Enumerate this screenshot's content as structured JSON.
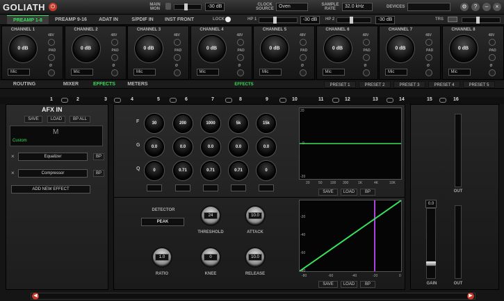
{
  "app": {
    "title": "GOLIATH"
  },
  "top": {
    "main_mon_label": "MAIN MON",
    "main_mon_db": "-30 dB",
    "clock_source_label": "CLOCK SOURCE",
    "clock_source_value": "Oven",
    "sample_rate_label": "SAMPLE RATE",
    "sample_rate_value": "32.0 kHz",
    "devices_label": "DEVICES"
  },
  "tabs": [
    "PREAMP 1-8",
    "PREAMP 9-16",
    "ADAT IN",
    "S/PDIF IN",
    "INST FRONT"
  ],
  "hp": {
    "lock_label": "LOCK",
    "hp1_label": "HP 1",
    "hp1_db": "-30 dB",
    "hp2_label": "HP 2",
    "hp2_db": "-30 dB",
    "trs_label": "TRS"
  },
  "channels": [
    {
      "name": "CHANNEL 1",
      "gain": "0 dB",
      "input": "Mic"
    },
    {
      "name": "CHANNEL 2",
      "gain": "0 dB",
      "input": "Mic"
    },
    {
      "name": "CHANNEL 3",
      "gain": "0 dB",
      "input": "Mic"
    },
    {
      "name": "CHANNEL 4",
      "gain": "0 dB",
      "input": "Mic"
    },
    {
      "name": "CHANNEL 5",
      "gain": "0 dB",
      "input": "Mic"
    },
    {
      "name": "CHANNEL 6",
      "gain": "0 dB",
      "input": "Mic"
    },
    {
      "name": "CHANNEL 7",
      "gain": "0 dB",
      "input": "Mic"
    },
    {
      "name": "CHANNEL 8",
      "gain": "0 dB",
      "input": "Mic"
    }
  ],
  "channel_switch_labels": {
    "phantom": "48V",
    "pad": "PAD",
    "phase": "Ø"
  },
  "subtabs": [
    "ROUTING",
    "MIXER",
    "EFFECTS",
    "METERS"
  ],
  "effects_label": "EFFECTS",
  "presets": [
    "PRESET 1",
    "PRESET 2",
    "PRESET 3",
    "PRESET 4",
    "PRESET 5"
  ],
  "numbers": [
    "1",
    "2",
    "3",
    "4",
    "5",
    "6",
    "7",
    "8",
    "9",
    "10",
    "11",
    "12",
    "13",
    "14",
    "15",
    "16"
  ],
  "afx": {
    "title": "AFX IN",
    "buttons": [
      "SAVE",
      "LOAD",
      "BP ALL"
    ],
    "preset_letter": "M",
    "preset_name": "Custom",
    "effects": [
      "Equalizer",
      "Compressor"
    ],
    "bp": "BP",
    "remove": "×",
    "add_effect": "ADD NEW EFFECT"
  },
  "eq": {
    "row_labels": [
      "F",
      "G",
      "Q"
    ],
    "freq": [
      "30",
      "200",
      "1000",
      "5k",
      "15k"
    ],
    "gain": [
      "0.0",
      "0.0",
      "0.0",
      "0.0",
      "0.0"
    ],
    "q": [
      "0",
      "0.71",
      "0.71",
      "0.71",
      "0"
    ],
    "buttons": [
      "SAVE",
      "LOAD",
      "BP"
    ],
    "y_ticks": [
      "20",
      "0",
      "-20"
    ],
    "x_ticks": [
      "20",
      "50",
      "100",
      "300",
      "1K",
      "4K",
      "10K"
    ]
  },
  "comp": {
    "detector_label": "DETECTOR",
    "detector_value": "PEAK",
    "knobs": [
      {
        "label": "THRESHOLD",
        "value": "24"
      },
      {
        "label": "ATTACK",
        "value": "10.0"
      },
      {
        "label": "RATIO",
        "value": "1.0"
      },
      {
        "label": "KNEE",
        "value": "0"
      },
      {
        "label": "RELEASE",
        "value": "10.0"
      }
    ],
    "buttons": [
      "SAVE",
      "LOAD",
      "BP"
    ],
    "x_ticks": [
      "-80",
      "-60",
      "-40",
      "-20",
      "0"
    ],
    "y_ticks": [
      "-20",
      "-40",
      "-60",
      "-80"
    ]
  },
  "right": {
    "gain_value": "0.0",
    "gain_label": "GAIN",
    "out_label": "OUT",
    "out_label2": "OUT"
  },
  "colors": {
    "accent": "#39e05a",
    "purple": "#b040e0",
    "red": "#c0392b"
  }
}
